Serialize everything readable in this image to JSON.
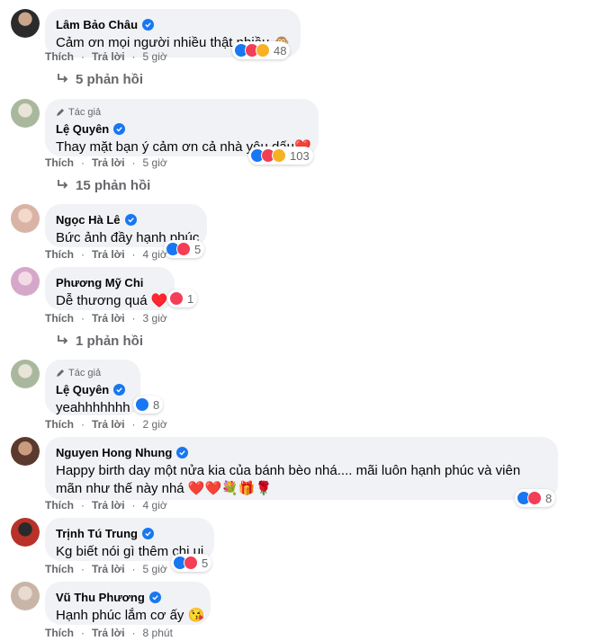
{
  "labels": {
    "like": "Thích",
    "reply": "Trả lời",
    "author_tag": "Tác giả"
  },
  "comments": [
    {
      "name": "Lâm Bảo Châu",
      "text": "Cảm ơn mọi người nhiều thật nhiều 🙊",
      "reactions": [
        "like-icon",
        "love-icon",
        "care-icon"
      ],
      "count": "48",
      "time": "5 giờ",
      "replies": "5 phản hồi",
      "avatar_color": "#2b2b2b"
    },
    {
      "name": "Lệ Quyên",
      "author": true,
      "text": "Thay mặt bạn ý cảm ơn cả nhà yêu dấu❤️",
      "reactions": [
        "like-icon",
        "love-icon",
        "care-icon"
      ],
      "count": "103",
      "time": "5 giờ",
      "replies": "15 phản hồi",
      "avatar_color": "#a9b89c"
    },
    {
      "name": "Ngọc Hà Lê",
      "text": "Bức ảnh đầy hạnh phúc",
      "reactions": [
        "like-icon",
        "love-icon"
      ],
      "count": "5",
      "time": "4 giờ",
      "avatar_color": "#d9b4a6"
    },
    {
      "name": "Phương Mỹ Chi",
      "verified": false,
      "text": "Dễ thương quá ♥️",
      "reactions": [
        "love-icon"
      ],
      "count": "1",
      "time": "3 giờ",
      "replies": "1 phản hồi",
      "avatar_color": "#d5a7c9"
    },
    {
      "name": "Lệ Quyên",
      "author": true,
      "text": "yeahhhhhhh",
      "reactions": [
        "like-icon"
      ],
      "count": "8",
      "time": "2 giờ",
      "avatar_color": "#a9b89c"
    },
    {
      "name": "Nguyen Hong Nhung",
      "text": "Happy birth day một nửa kia của bánh bèo nhá.... mãi luôn hạnh phúc và viên mãn như thế này nhá ❤️❤️💐🎁🌹",
      "reactions": [
        "like-icon",
        "love-icon"
      ],
      "count": "8",
      "time": "4 giờ",
      "avatar_color": "#5a3a2e"
    },
    {
      "name": "Trịnh Tú Trung",
      "text": "Kg biết nói gì thêm chị ui",
      "reactions": [
        "like-icon",
        "love-icon"
      ],
      "count": "5",
      "time": "5 giờ",
      "avatar_color": "#b8322a"
    },
    {
      "name": "Vũ Thu Phương",
      "text": "Hạnh phúc lắm cơ ấy 😘",
      "time": "8 phút",
      "avatar_color": "#c9b5a8"
    }
  ],
  "colors": {
    "bubble": "#f0f2f5",
    "meta": "#65676b",
    "verified": "#1877f2",
    "like": "#1877f2",
    "love": "#f33e58",
    "care": "#f7b125"
  }
}
